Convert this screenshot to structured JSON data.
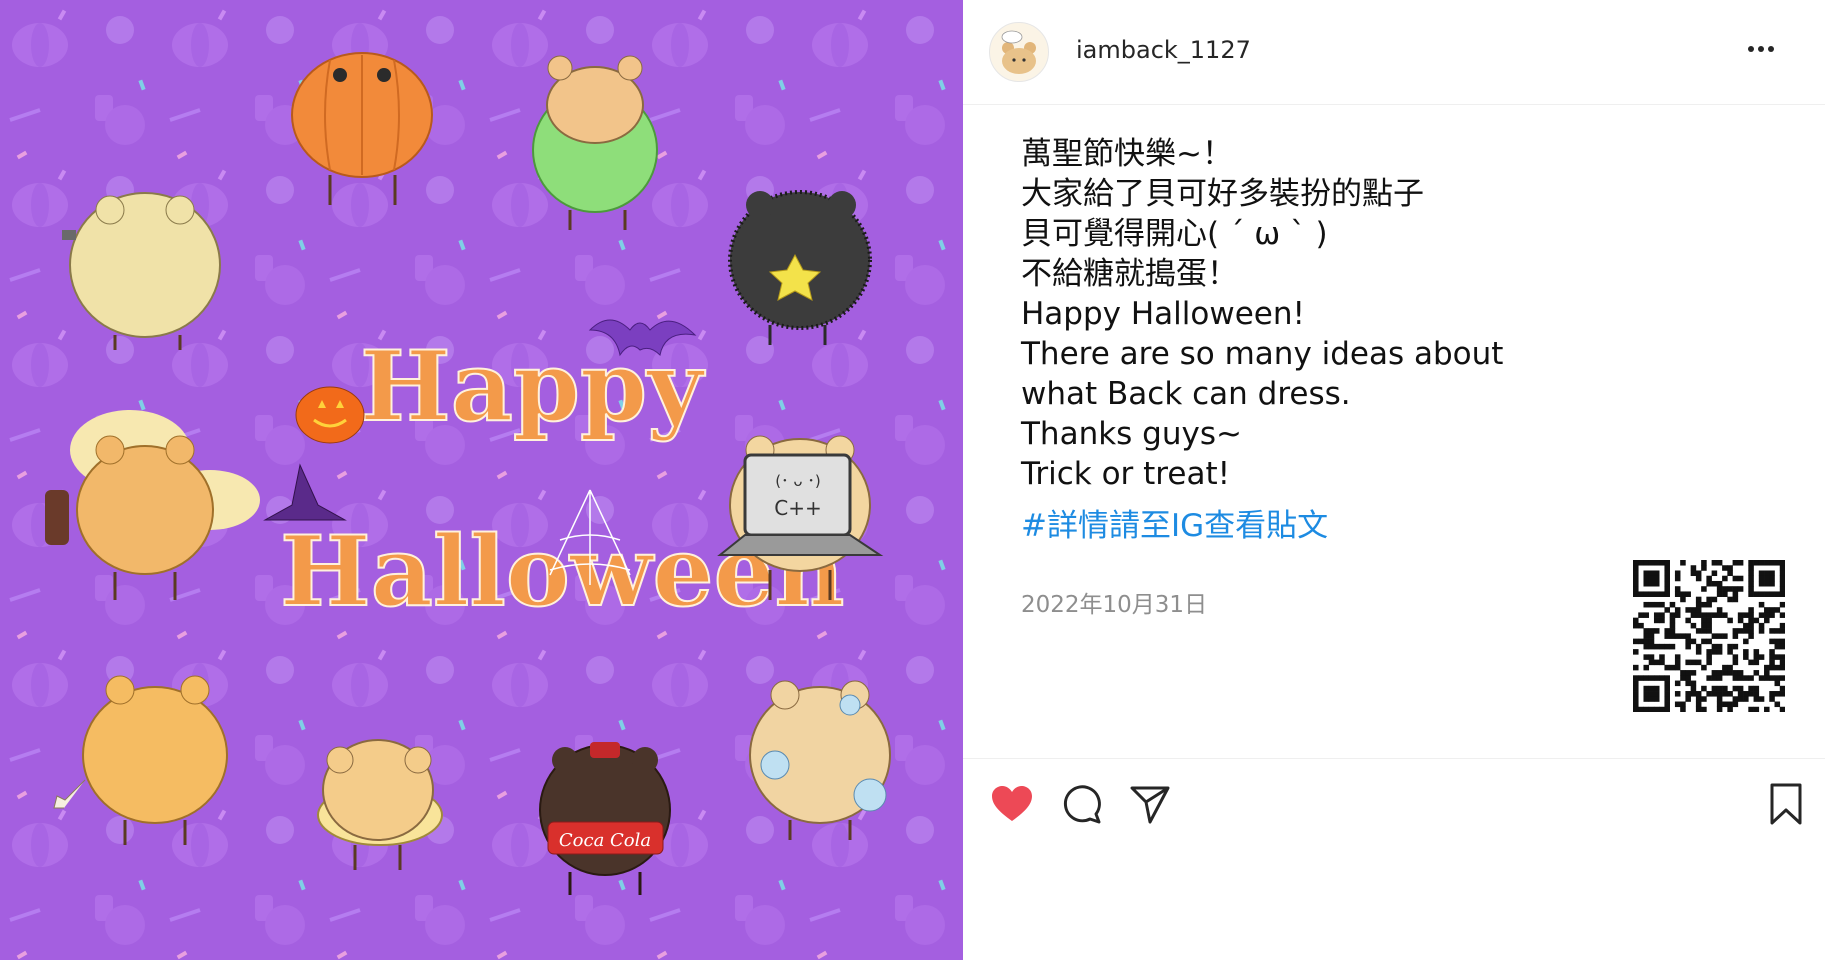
{
  "post": {
    "image": {
      "alt_visible_title_line1": "Happy",
      "alt_visible_title_line2": "Halloween",
      "shirt_text": "Coca Cola",
      "laptop_face": "(･ ᴗ ･)",
      "laptop_text": "C++",
      "background_color": "#a45fe0",
      "title_color": "#f39a4a"
    },
    "header": {
      "username": "iamback_1127",
      "avatar_icon": "bear-avatar-icon",
      "more_icon": "more-dots-icon"
    },
    "caption": {
      "lines": [
        "萬聖節快樂~！",
        "大家給了貝可好多裝扮的點子",
        "貝可覺得開心( ´ ω ` )",
        "不給糖就搗蛋！",
        "Happy Halloween!",
        "There are so many ideas about",
        "what Back can dress.",
        "Thanks guys~",
        "Trick or treat!"
      ],
      "hashtag": "#詳情請至IG查看貼文",
      "hashtag_color": "#1d8be2"
    },
    "date": "2022年10月31日",
    "actions": {
      "like_icon": "heart-filled-icon",
      "like_color": "#ed4956",
      "comment_icon": "comment-icon",
      "share_icon": "send-icon",
      "save_icon": "bookmark-icon"
    }
  }
}
